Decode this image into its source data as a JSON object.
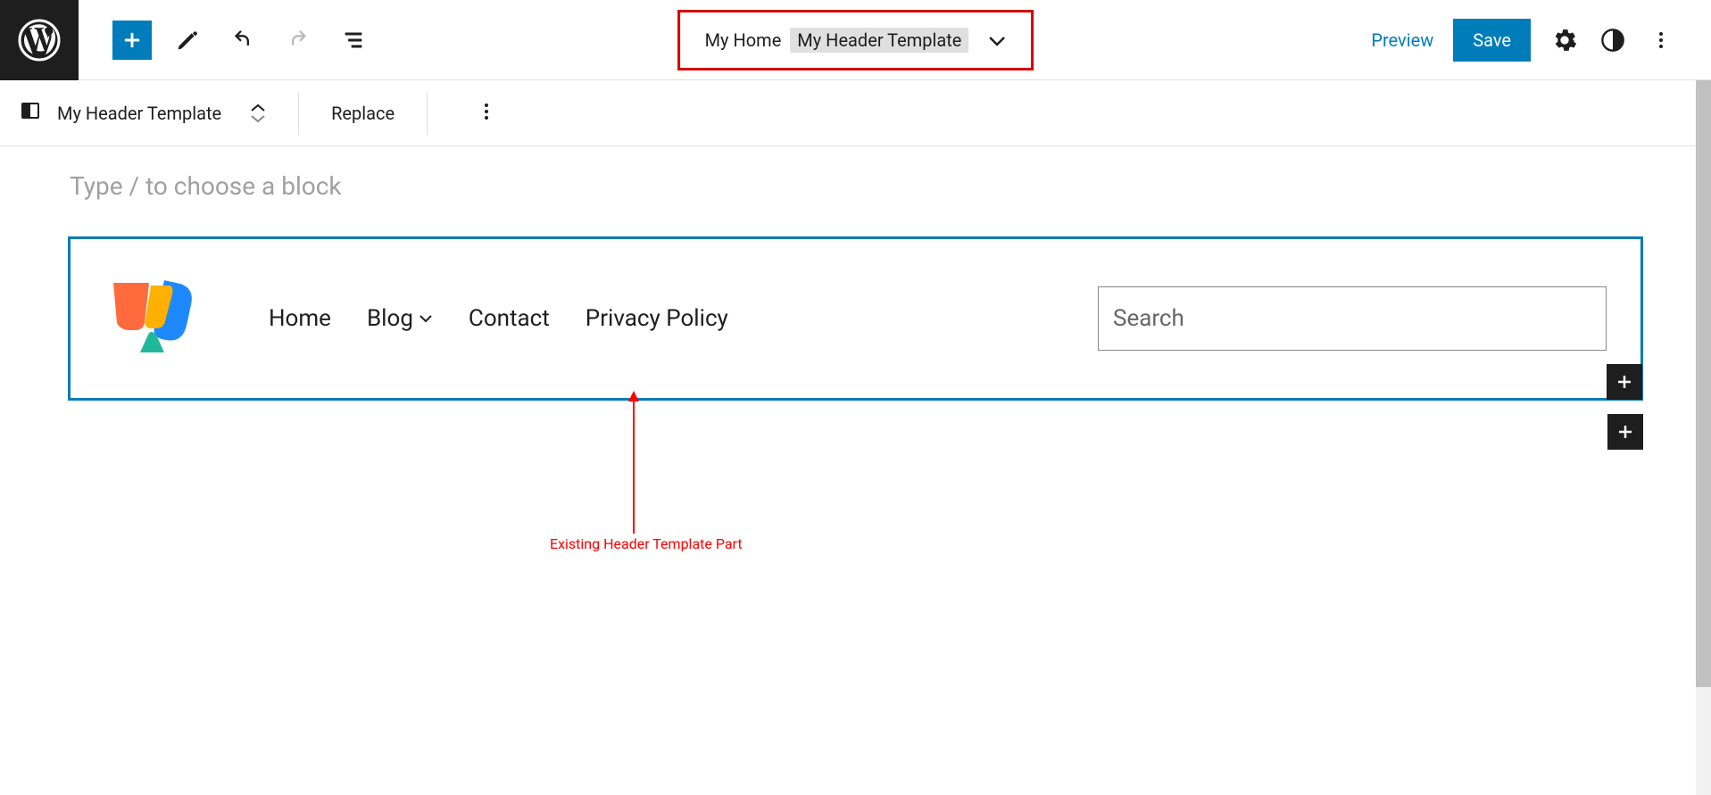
{
  "toolbar": {
    "page_name": "My Home",
    "template_name": "My Header Template",
    "preview_label": "Preview",
    "save_label": "Save"
  },
  "sub_toolbar": {
    "template_label": "My Header Template",
    "replace_label": "Replace"
  },
  "editor": {
    "placeholder": "Type / to choose a block"
  },
  "header_block": {
    "nav": {
      "items": [
        {
          "label": "Home",
          "has_submenu": false
        },
        {
          "label": "Blog",
          "has_submenu": true
        },
        {
          "label": "Contact",
          "has_submenu": false
        },
        {
          "label": "Privacy Policy",
          "has_submenu": false
        }
      ]
    },
    "search_placeholder": "Search"
  },
  "annotation": {
    "text": "Existing Header Template Part"
  }
}
